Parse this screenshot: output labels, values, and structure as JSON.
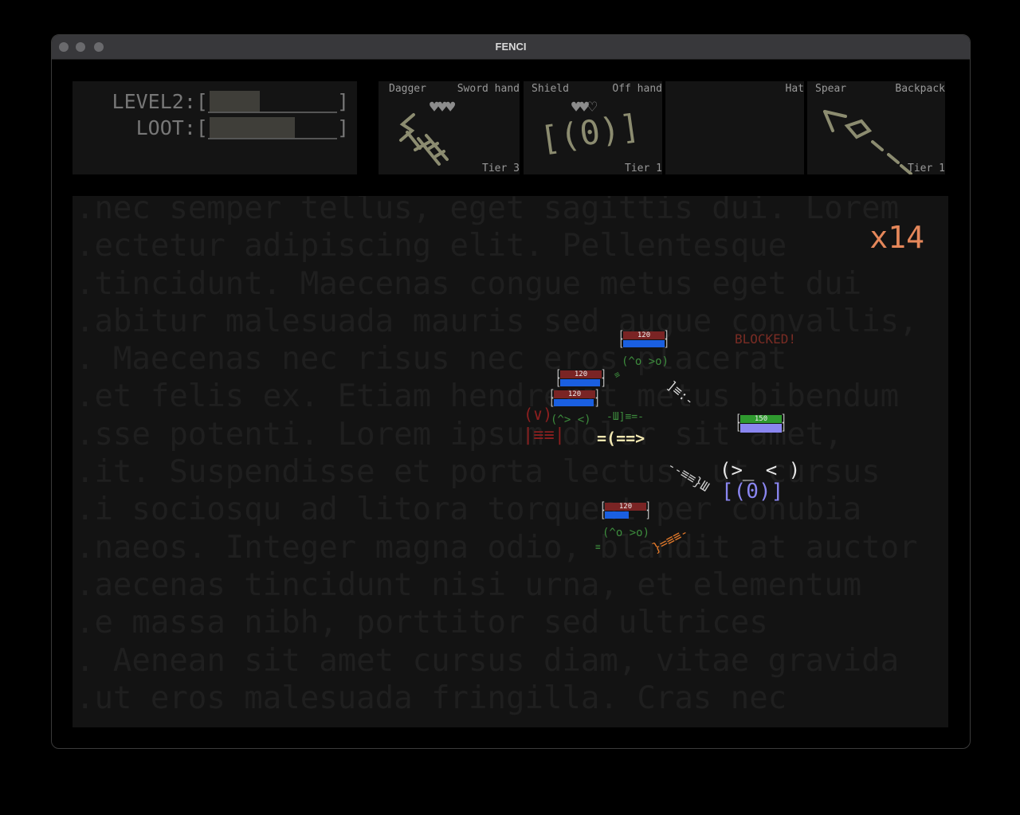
{
  "window": {
    "title": "FENCI"
  },
  "stats": {
    "level": {
      "label": "LEVEL2:",
      "open": "[",
      "close": "]",
      "progress": 0.4
    },
    "loot": {
      "label": "LOOT:",
      "open": "[",
      "close": "]",
      "progress": 0.68
    }
  },
  "slots": [
    {
      "left_label": "Dagger",
      "right_label": "Sword hand",
      "hearts": "♥♥♥",
      "tier": "Tier 3",
      "art": "weapon-sword-icon"
    },
    {
      "left_label": "Shield",
      "right_label": "Off hand",
      "hearts": "♥♥♡",
      "tier": "Tier 1",
      "art_text": "[(0)]"
    },
    {
      "left_label": "",
      "right_label": "Hat",
      "hearts": "",
      "tier": ""
    },
    {
      "left_label": "Spear",
      "right_label": "Backpack",
      "hearts": "",
      "tier": "Tier 1",
      "art": "spear-icon"
    }
  ],
  "arena": {
    "combo": "x14",
    "blocked_text": "BLOCKED!",
    "background_lines": [
      "...nec semper tellus, eget sagittis dui. Lorem",
      "...ectetur adipiscing elit. Pellentesque",
      "...tincidunt. Maecenas congue metus eget dui",
      "...abitur malesuada mauris sed augue convallis,",
      "... Maecenas nec risus nec eros placerat",
      "...et felis ex. Etiam hendrerit metus bibendum",
      "...sse potenti. Lorem ipsum dolor sit amet,",
      "...it. Suspendisse et porta lectus, ut cursus",
      "...i sociosqu ad litora torquent per conubia",
      "...naeos. Integer magna odio, blandit at auctor",
      "...aecenas tincidunt nisi urna, et elementum",
      "...e massa nibh, porttitor sed ultrices",
      "... Aenean sit amet cursus diam, vitae gravida",
      "...ut eros malesuada fringilla. Cras nec",
      "..."
    ],
    "enemies": [
      {
        "hp": "120",
        "face": "(^o >o)"
      },
      {
        "hp": "120",
        "face": ""
      },
      {
        "hp": "120",
        "face": "(^> <)"
      },
      {
        "hp": "120",
        "face": "(^o >o)"
      }
    ],
    "player": {
      "hp": "150",
      "face": "(>_ < )",
      "shield": "[(0)]",
      "sword": "=(==>"
    },
    "fallen_shield": "|≡≡|",
    "colors": {
      "enemy": "#3d8c3d",
      "player_hp": "#2f9a2f",
      "player_shield": "#8a86f0",
      "hp_red": "#7a2424",
      "hp_blue": "#1a5fe0",
      "combo": "#e5875a"
    }
  }
}
